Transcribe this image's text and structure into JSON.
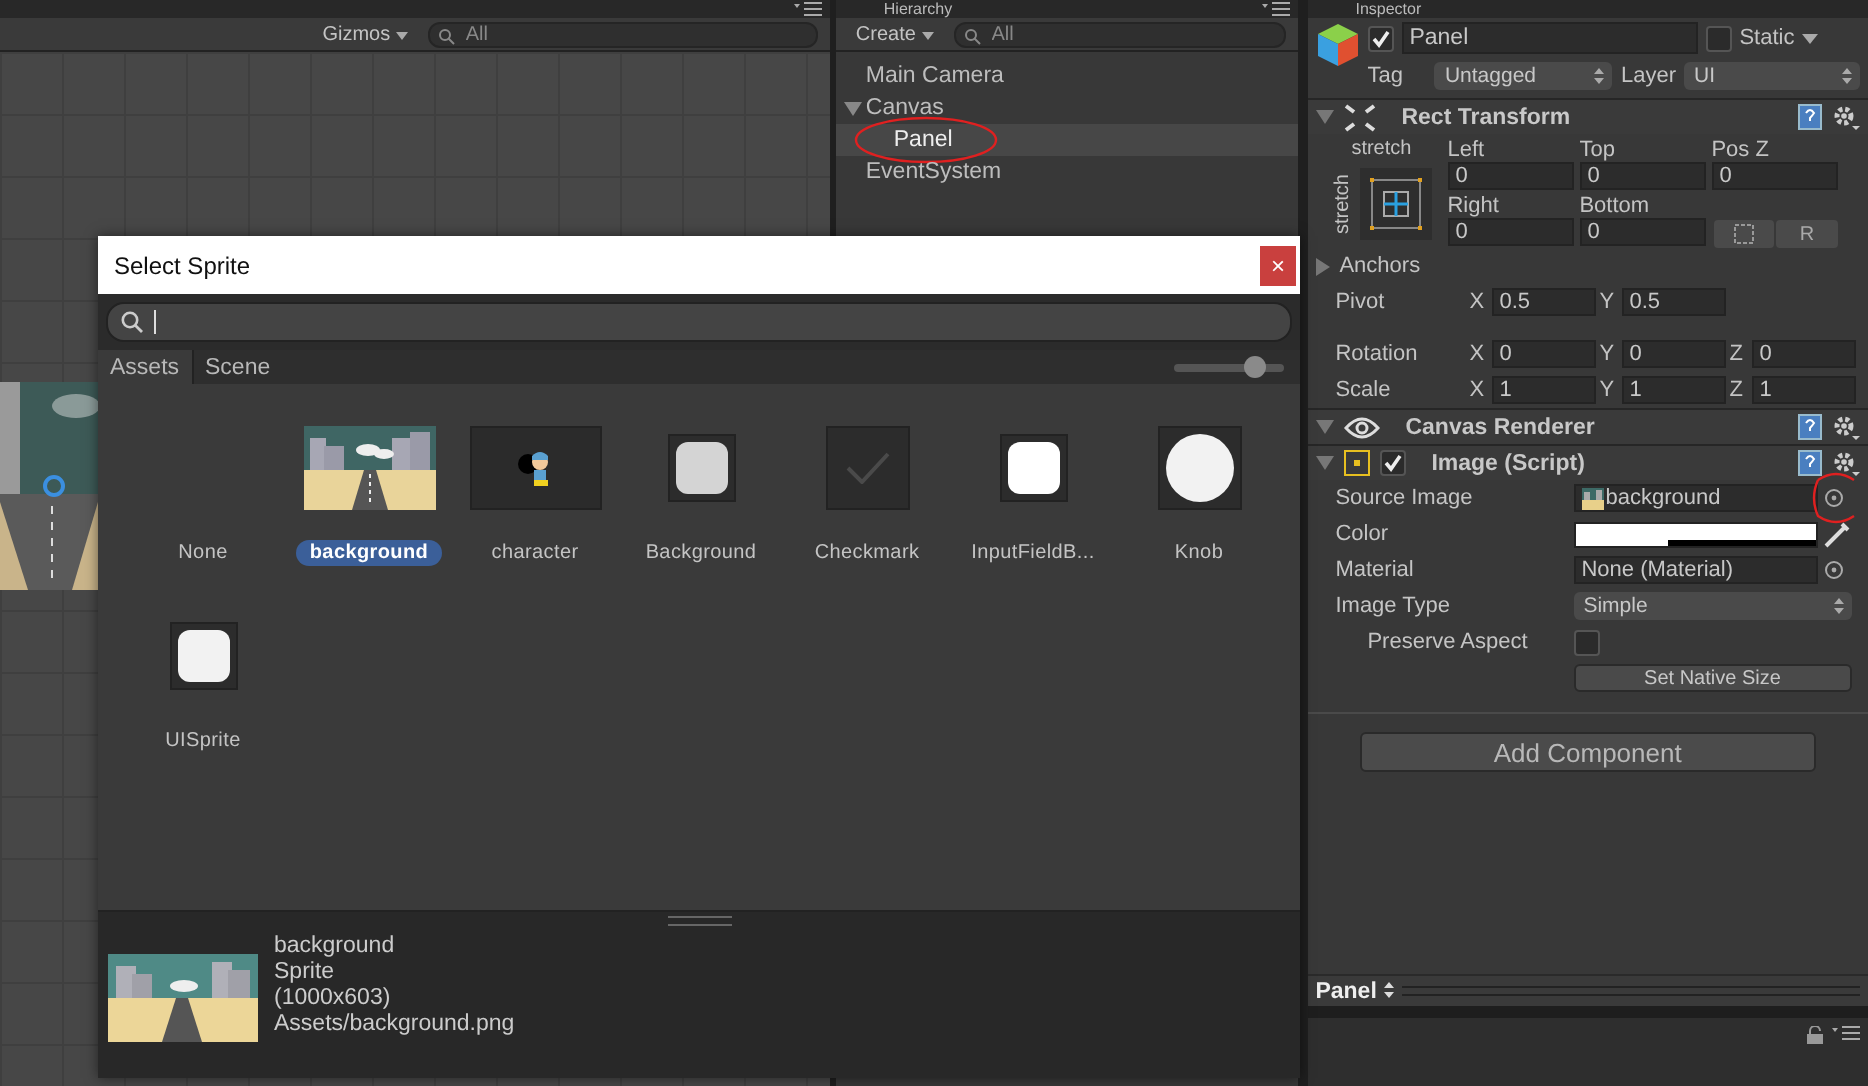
{
  "scene": {
    "gizmos": "Gizmos",
    "search_placeholder": "All"
  },
  "hierarchy": {
    "title": "Hierarchy",
    "create": "Create",
    "search_placeholder": "All",
    "items": [
      {
        "label": "Main Camera",
        "selected": false,
        "annotated": false
      },
      {
        "label": "Canvas",
        "selected": false,
        "annotated": false,
        "expanded": true,
        "children": [
          {
            "label": "Panel",
            "selected": true,
            "annotated": true
          }
        ]
      },
      {
        "label": "EventSystem",
        "selected": false,
        "annotated": false
      }
    ]
  },
  "inspector": {
    "title": "Inspector",
    "object": {
      "name": "Panel",
      "active": true,
      "static_label": "Static",
      "static": false,
      "tag_label": "Tag",
      "tag": "Untagged",
      "layer_label": "Layer",
      "layer": "UI"
    },
    "rect_transform": {
      "title": "Rect Transform",
      "preset_h": "stretch",
      "preset_v": "stretch",
      "fields": [
        {
          "label": "Left",
          "value": "0"
        },
        {
          "label": "Top",
          "value": "0"
        },
        {
          "label": "Pos Z",
          "value": "0"
        },
        {
          "label": "Right",
          "value": "0"
        },
        {
          "label": "Bottom",
          "value": "0"
        }
      ],
      "r_button": "R",
      "anchors": "Anchors",
      "anchors_expanded": false,
      "vectors": [
        {
          "label": "Pivot",
          "axes": [
            {
              "axis": "X",
              "value": "0.5"
            },
            {
              "axis": "Y",
              "value": "0.5"
            }
          ]
        },
        {
          "label": "Rotation",
          "axes": [
            {
              "axis": "X",
              "value": "0"
            },
            {
              "axis": "Y",
              "value": "0"
            },
            {
              "axis": "Z",
              "value": "0"
            }
          ]
        },
        {
          "label": "Scale",
          "axes": [
            {
              "axis": "X",
              "value": "1"
            },
            {
              "axis": "Y",
              "value": "1"
            },
            {
              "axis": "Z",
              "value": "1"
            }
          ]
        }
      ]
    },
    "canvas_renderer": {
      "title": "Canvas Renderer"
    },
    "image": {
      "title": "Image (Script)",
      "enabled": true,
      "props": [
        {
          "kind": "object",
          "label": "Source Image",
          "value": "background",
          "thumbnail": true,
          "annotated": true
        },
        {
          "kind": "color",
          "label": "Color",
          "color": "#ffffff"
        },
        {
          "kind": "object",
          "label": "Material",
          "value": "None (Material)",
          "thumbnail": false,
          "annotated": false
        },
        {
          "kind": "dropdown",
          "label": "Image Type",
          "value": "Simple"
        },
        {
          "kind": "checkbox",
          "label": "Preserve Aspect",
          "checked": false
        },
        {
          "kind": "button",
          "label": "Set Native Size"
        }
      ]
    },
    "add_component": "Add Component",
    "footer": {
      "name": "Panel"
    }
  },
  "dialog": {
    "title": "Select Sprite",
    "close": "×",
    "tabs": [
      {
        "label": "Assets",
        "selected": true
      },
      {
        "label": "Scene",
        "selected": false
      }
    ],
    "level": 0.75,
    "items": [
      {
        "name": "None",
        "kind": "none",
        "selected": false
      },
      {
        "name": "background",
        "kind": "picture",
        "selected": true
      },
      {
        "name": "character",
        "kind": "character",
        "selected": false
      },
      {
        "name": "Background",
        "kind": "rounded",
        "selected": false
      },
      {
        "name": "Checkmark",
        "kind": "check",
        "selected": false
      },
      {
        "name": "InputFieldB...",
        "kind": "field",
        "selected": false
      },
      {
        "name": "Knob",
        "kind": "circle",
        "selected": false
      },
      {
        "name": "UISprite",
        "kind": "rounded",
        "selected": false
      }
    ],
    "preview": {
      "name": "background",
      "type": "Sprite",
      "size": "(1000x603)",
      "path": "Assets/background.png"
    }
  }
}
